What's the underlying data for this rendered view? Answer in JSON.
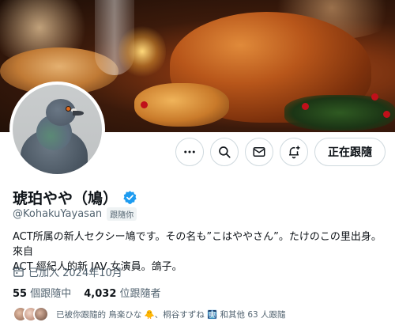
{
  "profile": {
    "display_name": "琥珀やや（鳩）",
    "handle": "@KohakuYayasan",
    "follows_you_badge": "跟隨你",
    "bio_line1": "ACT所属の新人セクシー鳩です。その名も”こはややさん”。たけのこの里出身。來自",
    "bio_line2": "ACT 經紀人的新 JAV 女演員。鴿子。",
    "joined": "已加入 2024年10月",
    "following_count": "55",
    "following_label": "個跟隨中",
    "followers_count": "4,032",
    "followers_label": "位跟隨者",
    "mutuals_text": "已被你跟隨的 鳥楽ひな 🐥、桐谷すずね 🩻 和其他 63 人跟隨"
  },
  "actions": {
    "more_icon": "more-icon",
    "search_icon": "search-icon",
    "message_icon": "mail-icon",
    "notify_icon": "bell-plus-icon",
    "follow_label": "正在跟隨"
  },
  "colors": {
    "verified_blue": "#1d9bf0",
    "muted_text": "#536471"
  }
}
